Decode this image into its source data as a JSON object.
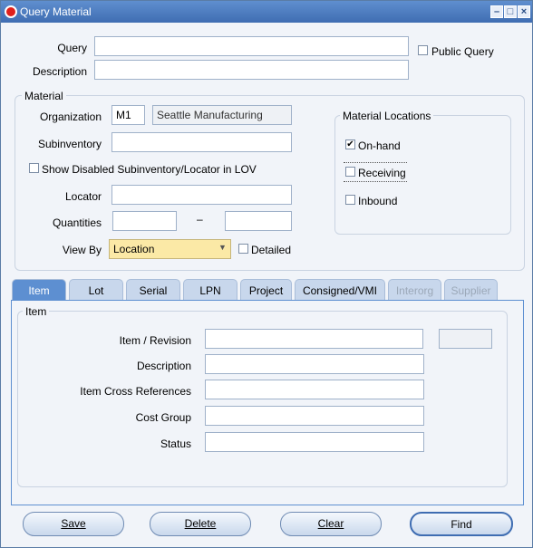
{
  "window": {
    "title": "Query Material"
  },
  "query": {
    "label": "Query",
    "value": ""
  },
  "description": {
    "label": "Description",
    "value": ""
  },
  "public_query": {
    "label": "Public Query",
    "checked": false
  },
  "material": {
    "legend": "Material",
    "organization_label": "Organization",
    "organization_code": "M1",
    "organization_name": "Seattle Manufacturing",
    "subinventory_label": "Subinventory",
    "subinventory_value": "",
    "show_disabled_label": "Show Disabled Subinventory/Locator in LOV",
    "locator_label": "Locator",
    "locator_value": "",
    "quantities_label": "Quantities",
    "quantities_separator": "–",
    "view_by_label": "View By",
    "view_by_value": "Location",
    "detailed_label": "Detailed"
  },
  "material_locations": {
    "legend": "Material Locations",
    "onhand_label": "On-hand",
    "onhand_checked": true,
    "receiving_label": "Receiving",
    "inbound_label": "Inbound"
  },
  "tabs": [
    {
      "label": "Item",
      "state": "active"
    },
    {
      "label": "Lot",
      "state": "enabled"
    },
    {
      "label": "Serial",
      "state": "enabled"
    },
    {
      "label": "LPN",
      "state": "enabled"
    },
    {
      "label": "Project",
      "state": "enabled"
    },
    {
      "label": "Consigned/VMI",
      "state": "enabled"
    },
    {
      "label": "Interorg",
      "state": "disabled"
    },
    {
      "label": "Supplier",
      "state": "disabled"
    }
  ],
  "item_panel": {
    "legend": "Item",
    "item_revision_label": "Item / Revision",
    "description_label": "Description",
    "cross_ref_label": "Item Cross References",
    "cost_group_label": "Cost Group",
    "status_label": "Status"
  },
  "buttons": {
    "save": "Save",
    "delete": "Delete",
    "clear": "Clear",
    "find": "Find"
  },
  "icons": {
    "logo": "oracle-logo-icon",
    "minimize": "minimize-icon",
    "maximize": "maximize-icon",
    "close": "close-icon",
    "dropdown": "chevron-down-icon",
    "check": "checkmark-icon"
  }
}
